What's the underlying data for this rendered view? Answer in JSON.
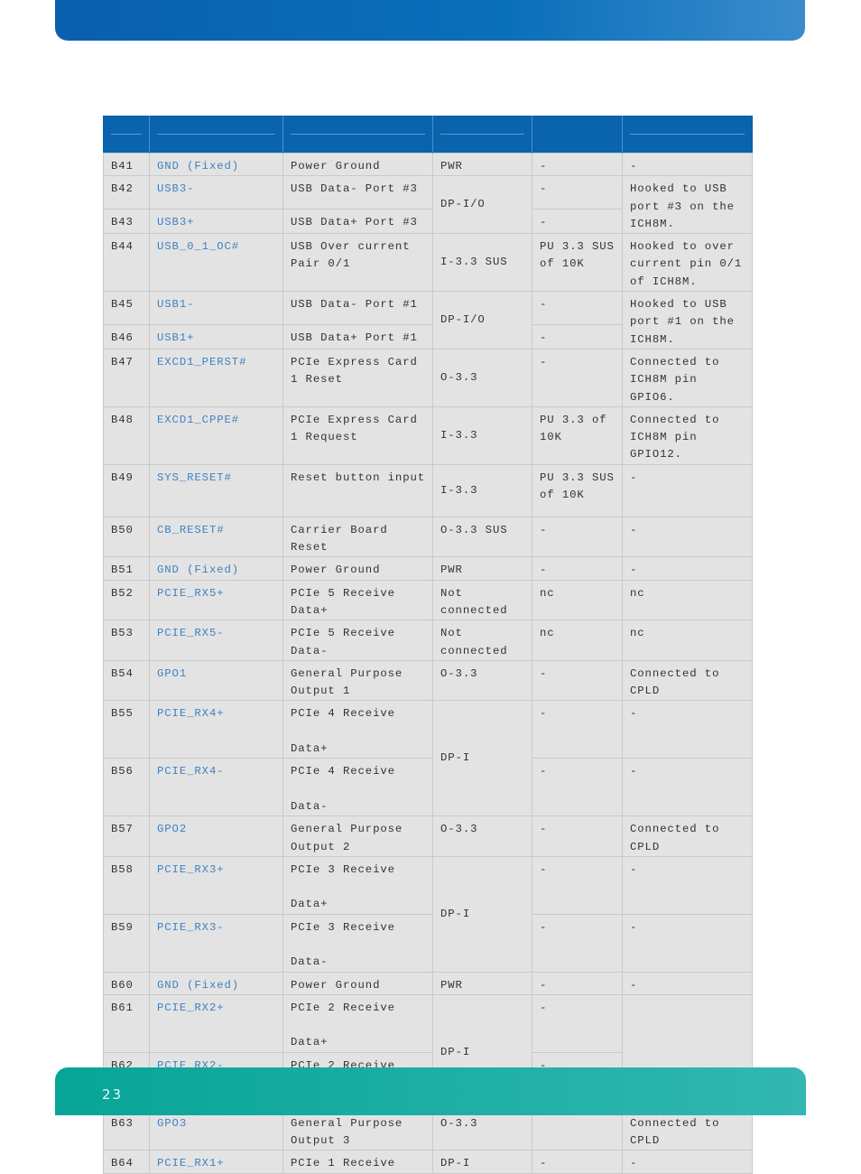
{
  "page_number": "23",
  "colors": {
    "header": "#0a63ad",
    "footer": "#07a597",
    "signal": "#3e82c4"
  },
  "rows": [
    [
      "B41",
      "GND (Fixed)",
      "Power Ground",
      "PWR",
      "-",
      "-"
    ],
    [
      "B42",
      "USB3-",
      "USB Data- Port #3",
      "DP-I/O",
      "-",
      "Hooked to USB port #3 on the ICH8M."
    ],
    [
      "B43",
      "USB3+",
      "USB Data+ Port #3",
      null,
      "-",
      null
    ],
    [
      "B44",
      "USB_0_1_OC#",
      "USB Over current Pair 0/1",
      "I-3.3 SUS",
      "PU 3.3 SUS of 10K",
      "Hooked to over current pin 0/1 of ICH8M."
    ],
    [
      "B45",
      "USB1-",
      "USB Data- Port #1",
      "DP-I/O",
      "-",
      "Hooked to USB port #1 on the ICH8M."
    ],
    [
      "B46",
      "USB1+",
      "USB Data+ Port #1",
      null,
      "-",
      null
    ],
    [
      "B47",
      "EXCD1_PERST#",
      "PCIe Express Card 1 Reset",
      "O-3.3",
      "-",
      "Connected to ICH8M pin GPIO6."
    ],
    [
      "B48",
      "EXCD1_CPPE#",
      "PCIe Express Card 1 Request",
      "I-3.3",
      "PU 3.3 of 10K",
      "Connected to ICH8M pin GPIO12."
    ],
    [
      "B49",
      "SYS_RESET#",
      "Reset button input",
      "I-3.3",
      "PU 3.3 SUS of 10K",
      "-"
    ],
    [
      "B50",
      "CB_RESET#",
      "Carrier Board Reset",
      "O-3.3 SUS",
      "-",
      "-"
    ],
    [
      "B51",
      "GND (Fixed)",
      "Power Ground",
      "PWR",
      "-",
      "-"
    ],
    [
      "B52",
      "PCIE_RX5+",
      "PCIe 5 Receive Data+",
      "Not connected",
      "nc",
      "nc"
    ],
    [
      "B53",
      "PCIE_RX5-",
      "PCIe 5 Receive Data-",
      "Not connected",
      "nc",
      "nc"
    ],
    [
      "B54",
      "GPO1",
      "General Purpose Output 1",
      "O-3.3",
      "-",
      "Connected to CPLD"
    ],
    [
      "B55",
      "PCIE_RX4+",
      "PCIe 4 Receive\n\nData+",
      "DP-I",
      "-",
      "-"
    ],
    [
      "B56",
      "PCIE_RX4-",
      "PCIe 4 Receive\n\nData-",
      null,
      "-",
      "-"
    ],
    [
      "B57",
      "GPO2",
      "General Purpose Output 2",
      "O-3.3",
      "-",
      "Connected to CPLD"
    ],
    [
      "B58",
      "PCIE_RX3+",
      "PCIe 3 Receive\n\nData+",
      "DP-I",
      "-",
      "-"
    ],
    [
      "B59",
      "PCIE_RX3-",
      "PCIe 3 Receive\n\nData-",
      null,
      "-",
      "-"
    ],
    [
      "B60",
      "GND (Fixed)",
      "Power Ground",
      "PWR",
      "-",
      "-"
    ],
    [
      "B61",
      "PCIE_RX2+",
      "PCIe 2 Receive\n\nData+",
      "DP-I",
      "-",
      ""
    ],
    [
      "B62",
      "PCIE_RX2-",
      "PCIe 2 Receive\n\nData-",
      null,
      "-",
      null
    ],
    [
      "B63",
      "GPO3",
      "General Purpose Output 3",
      "O-3.3",
      "",
      "Connected to CPLD"
    ],
    [
      "B64",
      "PCIE_RX1+",
      "PCIe 1 Receive",
      "DP-I",
      "-",
      "-"
    ]
  ]
}
